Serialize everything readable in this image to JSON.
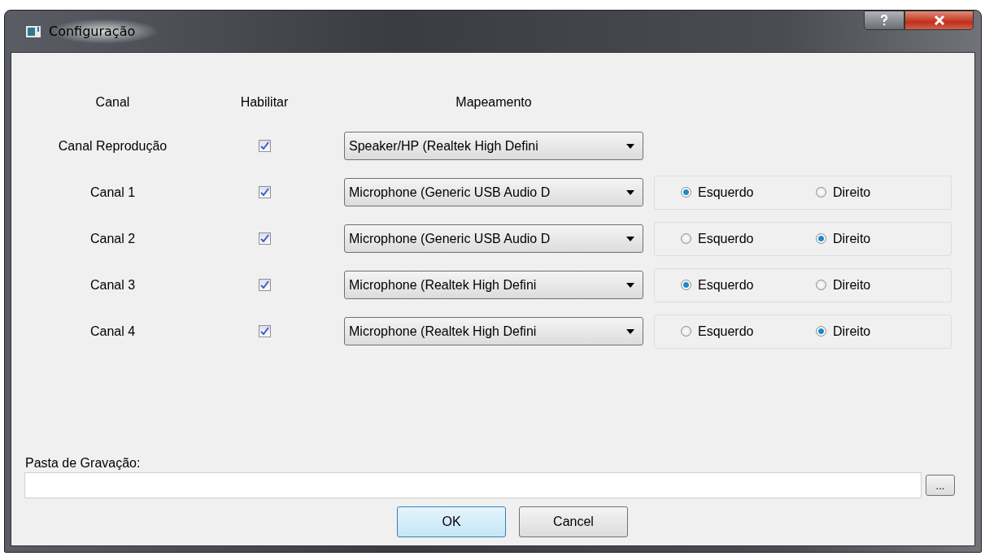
{
  "window": {
    "title": "Configuração"
  },
  "columns": [
    "Canal",
    "Habilitar",
    "Mapeamento"
  ],
  "channels": [
    {
      "name": "Canal Reprodução",
      "enabled": true,
      "device": "Speaker/HP (Realtek High Defini"
    },
    {
      "name": "Canal 1",
      "enabled": true,
      "device": "Microphone (Generic USB Audio D",
      "sides": [
        {
          "label": "Esquerdo",
          "selected": true
        },
        {
          "label": "Direito",
          "selected": false
        }
      ]
    },
    {
      "name": "Canal 2",
      "enabled": true,
      "device": "Microphone (Generic USB Audio D",
      "sides": [
        {
          "label": "Esquerdo",
          "selected": false
        },
        {
          "label": "Direito",
          "selected": true
        }
      ]
    },
    {
      "name": "Canal 3",
      "enabled": true,
      "device": "Microphone (Realtek High Defini",
      "sides": [
        {
          "label": "Esquerdo",
          "selected": true
        },
        {
          "label": "Direito",
          "selected": false
        }
      ]
    },
    {
      "name": "Canal 4",
      "enabled": true,
      "device": "Microphone (Realtek High Defini",
      "sides": [
        {
          "label": "Esquerdo",
          "selected": false
        },
        {
          "label": "Direito",
          "selected": true
        }
      ]
    }
  ],
  "folder": {
    "label": "Pasta de Gravação:",
    "browse": "..."
  },
  "buttons": [
    {
      "label": "OK",
      "default": true
    },
    {
      "label": "Cancel",
      "default": false
    }
  ]
}
